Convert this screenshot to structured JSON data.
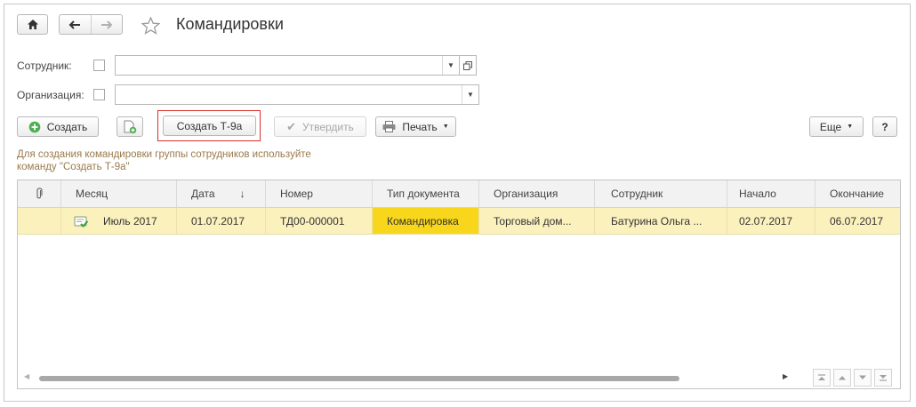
{
  "window": {
    "title": "Командировки",
    "icons": {
      "home": "home-icon",
      "back": "arrow-left-icon",
      "forward": "arrow-right-icon",
      "star": "star-icon"
    }
  },
  "filters": {
    "employee_label": "Сотрудник:",
    "employee_value": "",
    "organization_label": "Организация:",
    "organization_value": ""
  },
  "toolbar": {
    "create_label": "Создать",
    "create_t9a_label": "Создать Т-9а",
    "approve_label": "Утвердить",
    "print_label": "Печать",
    "more_label": "Еще",
    "help_label": "?"
  },
  "hint": {
    "line1": "Для создания командировки группы сотрудников используйте",
    "line2": "команду \"Создать Т-9а\""
  },
  "table": {
    "columns": [
      "Месяц",
      "Дата",
      "Номер",
      "Тип документа",
      "Организация",
      "Сотрудник",
      "Начало",
      "Окончание"
    ],
    "sort_indicator": "↓",
    "rows": [
      {
        "month": "Июль 2017",
        "date": "01.07.2017",
        "number": "ТД00-000001",
        "doc_type": "Командировка",
        "organization": "Торговый дом...",
        "employee": "Батурина Ольга ...",
        "start": "02.07.2017",
        "end": "06.07.2017"
      }
    ]
  },
  "colors": {
    "selected_row": "#fbf1bd",
    "highlight_cell": "#f7d61c",
    "accent_border": "#d9302a",
    "hint_text": "#9a7a4a"
  }
}
